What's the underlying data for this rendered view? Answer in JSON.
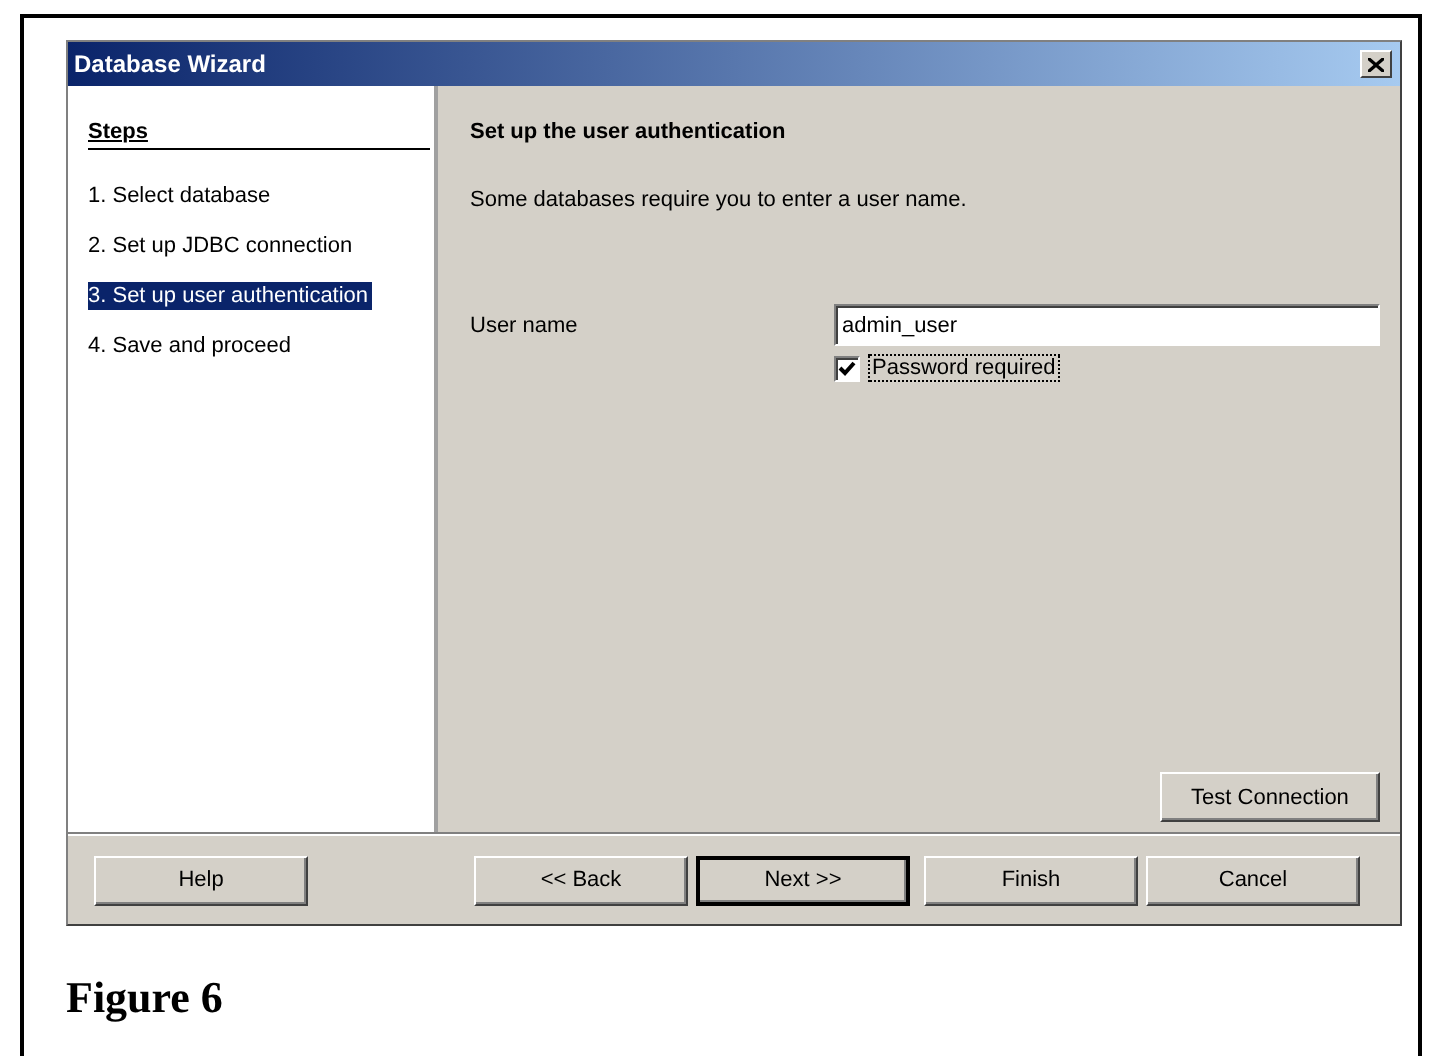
{
  "window": {
    "title": "Database Wizard"
  },
  "steps": {
    "heading": "Steps",
    "items": [
      {
        "label": "1.  Select database",
        "selected": false
      },
      {
        "label": "2.  Set up JDBC connection",
        "selected": false
      },
      {
        "label": "3.  Set up user authentication",
        "selected": true
      },
      {
        "label": "4.  Save and proceed",
        "selected": false
      }
    ]
  },
  "page": {
    "heading": "Set up the user authentication",
    "description": "Some databases require you to enter a user name.",
    "user_name": {
      "label": "User name",
      "value": "admin_user"
    },
    "password_required": {
      "label": "Password required",
      "checked": true
    },
    "test_button": "Test Connection"
  },
  "buttons": [
    {
      "label": "Help",
      "default": false
    },
    {
      "label": "<< Back",
      "default": false
    },
    {
      "label": "Next >>",
      "default": true
    },
    {
      "label": "Finish",
      "default": false
    },
    {
      "label": "Cancel",
      "default": false
    }
  ],
  "caption": "Figure 6"
}
